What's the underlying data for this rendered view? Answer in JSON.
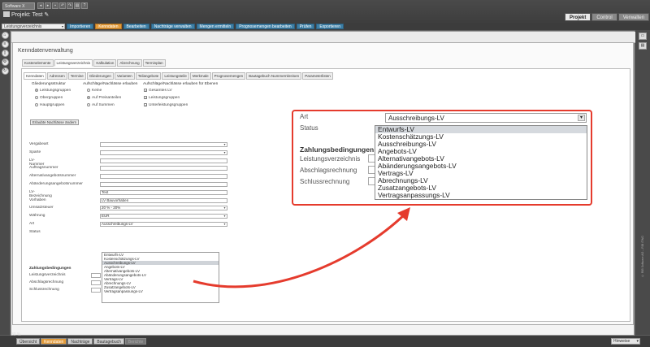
{
  "app": {
    "selector": "Software X",
    "project_prefix": "Projekt:",
    "project_name": "Test"
  },
  "main_tabs": [
    "Projekt",
    "Control",
    "Verwalten"
  ],
  "ribbon": {
    "select_value": "Leistungsverzeichnis",
    "items": [
      {
        "label": "Importieren",
        "active": false
      },
      {
        "label": "Kenndaten",
        "active": true
      },
      {
        "label": "Bearbeiten",
        "active": false
      },
      {
        "label": "Nachträge verwalten",
        "active": false
      },
      {
        "label": "Mengen ermitteln",
        "active": false
      },
      {
        "label": "Prognosemengen bearbeiten",
        "active": false
      },
      {
        "label": "Prüfen",
        "active": false
      },
      {
        "label": "Exportieren",
        "active": false
      }
    ]
  },
  "panel": {
    "title": "Kenndatenverwaltung",
    "outer_tabs": [
      "Kostenelemente",
      "Leistungsverzeichnis",
      "Kalkulation",
      "Abrechnung",
      "Terminplan"
    ],
    "inner_tabs": [
      "Kenndaten",
      "Adressen",
      "Termine",
      "Gliederungen",
      "Varianten",
      "Teilangebote",
      "Leistungsteile",
      "Merkmale",
      "Prognosemengen",
      "Bautagebuch Nummernkreisen",
      "Parameterlisten"
    ]
  },
  "structure": {
    "col1_title": "Gliederungsstruktur",
    "col1_options": [
      {
        "label": "Leistungsgruppen",
        "checked": true
      },
      {
        "label": "Obergruppen",
        "checked": false
      },
      {
        "label": "Hauptgruppen",
        "checked": false
      }
    ],
    "col2_title": "Aufschläge/Nachlässe erlauben",
    "col2_options": [
      {
        "label": "Keine",
        "checked": false
      },
      {
        "label": "Auf Preisanteilen",
        "checked": true
      },
      {
        "label": "Auf Summen",
        "checked": false
      }
    ],
    "col3_title": "Aufschläge/Nachlässe erlauben für Ebenen",
    "col3_options": [
      {
        "label": "Gesamtes LV",
        "checked": true
      },
      {
        "label": "Leistungsgruppen",
        "checked": true
      },
      {
        "label": "Unterleistungsgruppen",
        "checked": true
      }
    ],
    "rights_button": "Erlaubte Nachlässe ändern"
  },
  "form": {
    "fields": [
      {
        "label": "Vergabeart",
        "value": "",
        "select": true
      },
      {
        "label": "Sparte",
        "value": "",
        "select": true
      },
      {
        "label": "LV-Nummer",
        "value": "",
        "select": false
      },
      {
        "label": "Auftragsnummer",
        "value": "",
        "select": false
      },
      {
        "label": "Alternativangebotsnummer",
        "value": "",
        "select": false
      },
      {
        "label": "Abänderungsangebotsnummer",
        "value": "",
        "select": false
      },
      {
        "label": "LV-Bezeichnung",
        "value": "Test",
        "select": false
      },
      {
        "label": "Vorhaben",
        "value": "LV Bauvorhaben",
        "select": false
      },
      {
        "label": "Umsatzsteuer",
        "value": "20 % - 20%",
        "select": true
      },
      {
        "label": "Währung",
        "value": "EUR",
        "select": true
      },
      {
        "label": "Art",
        "value": "Ausschreibungs-LV",
        "select": true
      },
      {
        "label": "Status",
        "value": "",
        "select": false
      }
    ],
    "payment_title": "Zahlungsbedingungen",
    "payment_fields": [
      "Leistungsverzeichnis",
      "Abschlagsrechnung",
      "Schlussrechnung"
    ]
  },
  "art_options": [
    "Entwurfs-LV",
    "Kostenschätzungs-LV",
    "Ausschreibungs-LV",
    "Angebots-LV",
    "Alternativangebots-LV",
    "Abänderungsangebots-LV",
    "Vertrags-LV",
    "Abrechnungs-LV",
    "Zusatzangebots-LV",
    "Vertragsanpassungs-LV"
  ],
  "art_selected": "Ausschreibungs-LV",
  "zoom": {
    "art_label": "Art",
    "status_label": "Status",
    "payment_title": "Zahlungsbedingungen",
    "payment_fields": [
      "Leistungsverzeichnis",
      "Abschlagsrechnung",
      "Schlussrechnung"
    ]
  },
  "bottom_tabs": [
    {
      "label": "Übersicht",
      "state": "normal"
    },
    {
      "label": "Kenndaten",
      "state": "active"
    },
    {
      "label": "Nachträge",
      "state": "normal"
    },
    {
      "label": "Bautagebuch",
      "state": "normal"
    },
    {
      "label": "Berichte",
      "state": "disabled"
    }
  ],
  "hints_label": "Hinweise",
  "zoom_level": "30 %",
  "watermark": "© RIB Software AG – RIB iTWO",
  "colors": {
    "accent_orange": "#e39b3a",
    "ribbon_blue": "#3d7fa6",
    "highlight_red": "#e53b2d"
  }
}
